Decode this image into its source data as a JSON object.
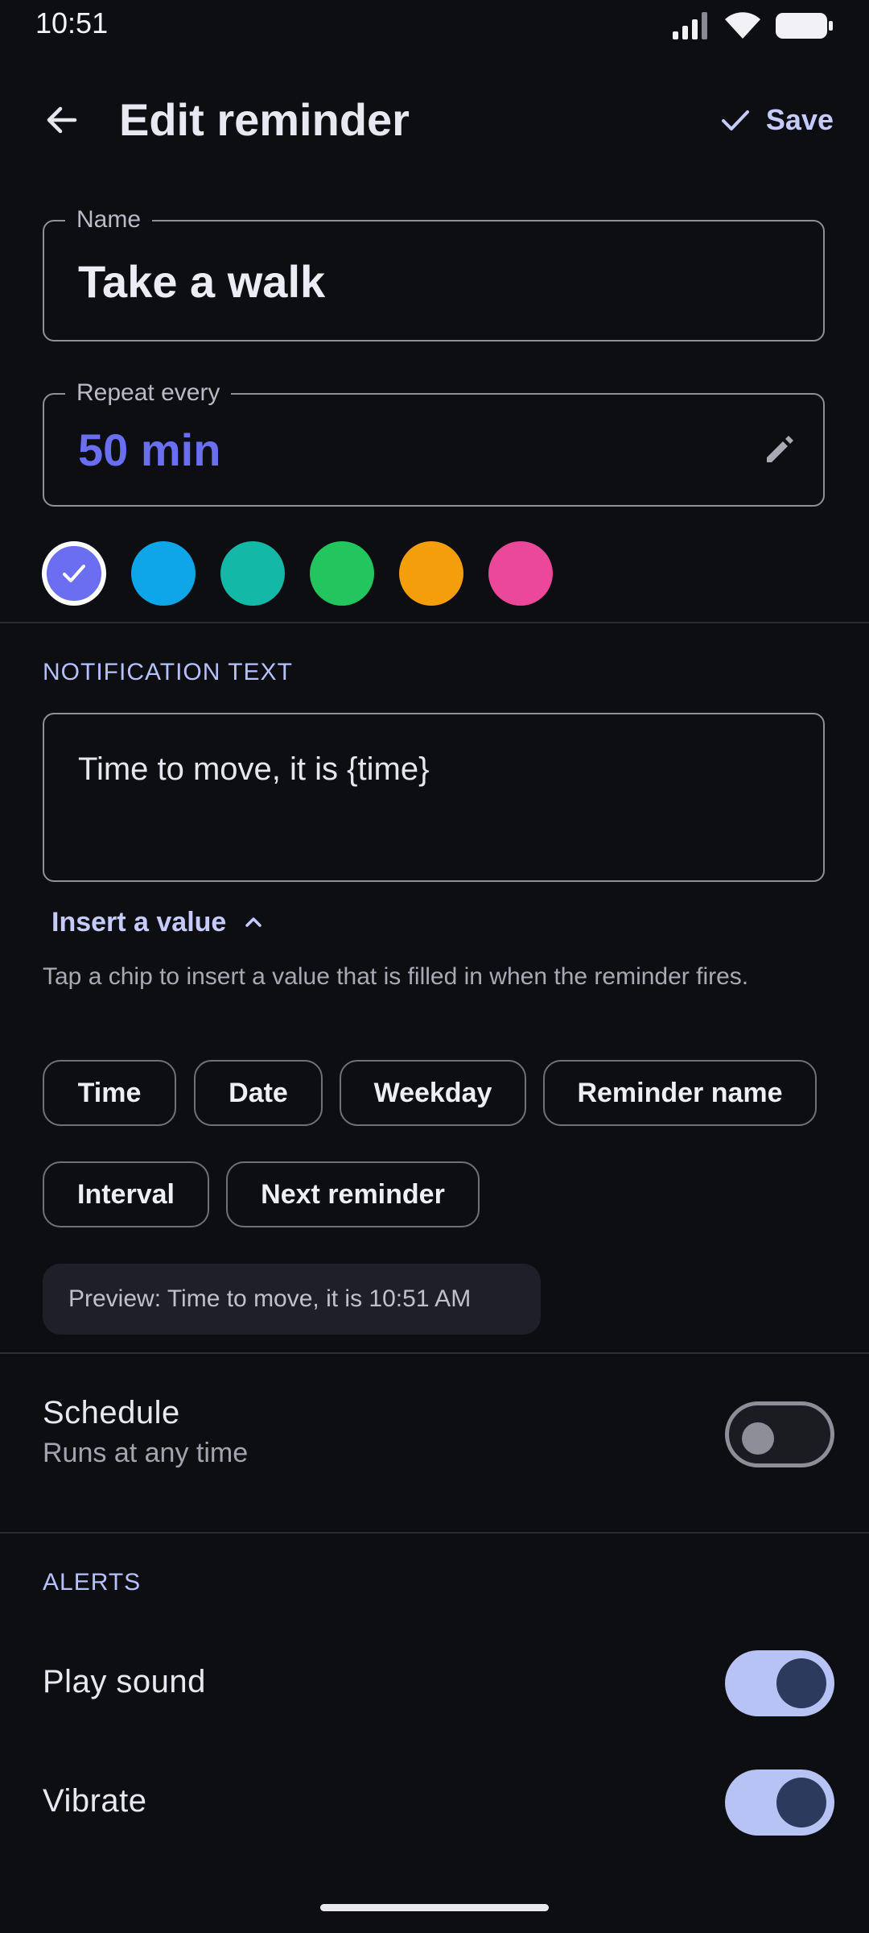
{
  "status_bar": {
    "time": "10:51",
    "icons": [
      "signal-icon",
      "wifi-icon",
      "battery-icon"
    ]
  },
  "app_bar": {
    "back_icon": "arrow-back-icon",
    "title": "Edit reminder",
    "save_icon": "check-icon",
    "save_label": "Save"
  },
  "name_field": {
    "label": "Name",
    "value": "Take a walk"
  },
  "repeat_field": {
    "label": "Repeat every",
    "value": "50 min",
    "edit_icon": "pencil-icon"
  },
  "colors": {
    "options": [
      "#6b6ef0",
      "#0ea5e9",
      "#14b8a6",
      "#22c55e",
      "#f59e0b",
      "#ec4899"
    ],
    "selected_index": 0
  },
  "notification": {
    "header": "NOTIFICATION TEXT",
    "text": "Time to move, it is {time}",
    "insert_toggle_label": "Insert a value",
    "insert_toggle_icon": "chevron-up-icon",
    "helper": "Tap a chip to insert a value that is filled in when the reminder fires.",
    "chips": [
      "Time",
      "Date",
      "Weekday",
      "Reminder name",
      "Interval",
      "Next reminder"
    ],
    "preview": "Preview: Time to move, it is 10:51 AM"
  },
  "schedule": {
    "title": "Schedule",
    "subtitle": "Runs at any time",
    "enabled": false
  },
  "alerts": {
    "header": "ALERTS",
    "play_sound": {
      "label": "Play sound",
      "enabled": true
    },
    "vibrate": {
      "label": "Vibrate",
      "enabled": true
    }
  },
  "theme": {
    "background": "#0d0e12",
    "accent": "#c5cbff",
    "interval_color": "#6a6ef0"
  }
}
